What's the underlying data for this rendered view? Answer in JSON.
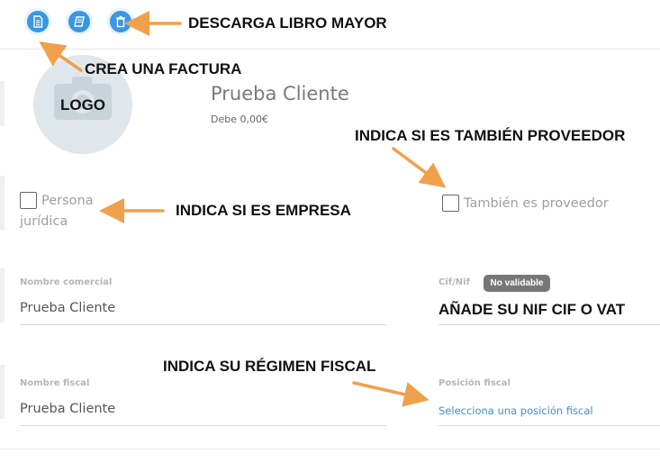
{
  "toolbar": {
    "buttons": [
      {
        "icon": "document-icon"
      },
      {
        "icon": "book-icon"
      },
      {
        "icon": "trash-icon"
      }
    ]
  },
  "annotations": {
    "ledger": "DESCARGA LIBRO MAYOR",
    "invoice": "CREA UNA FACTURA",
    "supplier": "INDICA SI ES TAMBIÉN PROVEEDOR",
    "company": "INDICA SI ES EMPRESA",
    "tax_id": "AÑADE SU NIF CIF O VAT",
    "tax_regime": "INDICA SU RÉGIMEN FISCAL"
  },
  "profile": {
    "logo_label": "LOGO",
    "client_name": "Prueba Cliente",
    "debt": "Debe 0,00€"
  },
  "checkboxes": {
    "legal_person_line1": "Persona",
    "legal_person_line2": "jurídica",
    "supplier": "También es proveedor"
  },
  "fields": {
    "trade_name": {
      "label": "Nombre comercial",
      "value": "Prueba Cliente"
    },
    "tax_id": {
      "label": "Cif/Nif",
      "badge": "No validable"
    },
    "fiscal_name": {
      "label": "Nombre fiscal",
      "value": "Prueba Cliente"
    },
    "fiscal_position": {
      "label": "Posición fiscal",
      "link": "Selecciona una posición fiscal"
    }
  },
  "colors": {
    "accent": "#3a97e0",
    "annotation_arrow": "#f0a04b",
    "link": "#3a8fd8",
    "badge": "#777777"
  }
}
